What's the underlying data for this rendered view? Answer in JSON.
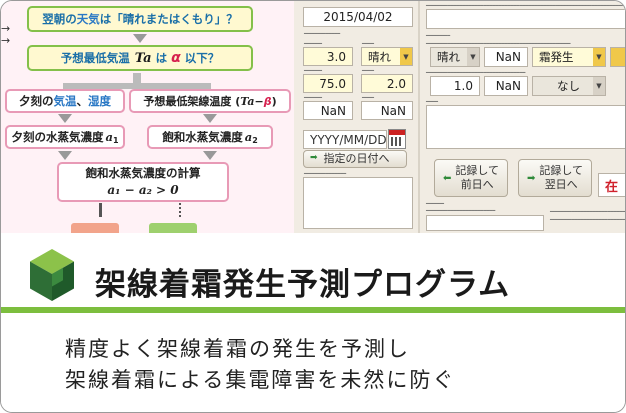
{
  "flowchart": {
    "q1_prefix": "翌朝の",
    "q1_weather": "天気",
    "q1_suffix": "は「晴れまたはくもり」？",
    "q2_prefix": "予想最低気温",
    "q2_var": "Ta",
    "q2_mid": " は ",
    "q2_alpha": "α",
    "q2_suffix": " 以下？",
    "left_top_prefix": "夕刻の",
    "left_top_temp": "気温",
    "left_top_sep": "、",
    "left_top_hum": "湿度",
    "right_top_prefix": "予想最低架線温度 (",
    "right_top_var": "Ta",
    "right_top_minus": "−",
    "right_top_beta": "β",
    "right_top_suffix": ")",
    "left_vapor": "夕刻の水蒸気濃度",
    "left_vapor_var": "a",
    "left_vapor_sub": "1",
    "right_vapor": "飽和水蒸気濃度",
    "right_vapor_var": "a",
    "right_vapor_sub": "2",
    "calc_label": "飽和水蒸気濃度の計算",
    "calc_formula": "a₁ − a₂ > 0",
    "arrow_marks": "→\n→"
  },
  "app": {
    "date_value": "2015/04/02",
    "temp_value": "3.0",
    "hum_value": "75.0",
    "extra_value": "NaN",
    "weather_select": "晴れ",
    "wind_value": "2.0",
    "nan_a": "NaN",
    "date_placeholder": "YYYY/MM/DD",
    "goto_date_label": "指定の日付へ",
    "next_weather": "晴れ",
    "next_nan1": "NaN",
    "frost_select": "霜発生",
    "next_temp": "1.0",
    "next_nan2": "NaN",
    "none_select": "なし",
    "record_prev_label": "記録して\n前日へ",
    "record_next_label": "記録して\n翌日へ",
    "red_label": "在"
  },
  "band": {
    "title": "架線着霜発生予測プログラム",
    "desc_line1": "精度よく架線着霜の発生を予測し",
    "desc_line2": "架線着霜による集電障害を未然に防ぐ"
  },
  "colors": {
    "accent_green": "#7cbe3e",
    "flow_bg": "#fff2f6",
    "logo_dark": "#2e6e36",
    "logo_light": "#8cc24a"
  }
}
